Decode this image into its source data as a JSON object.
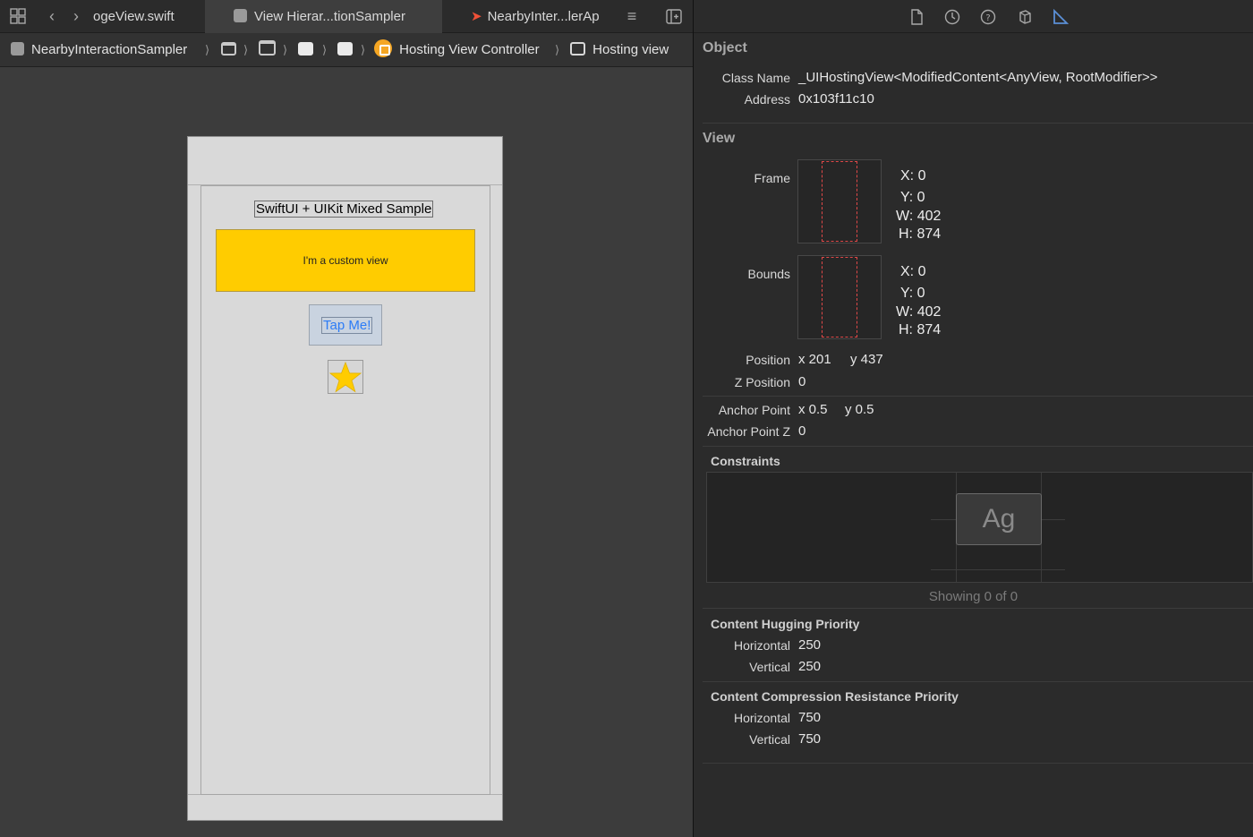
{
  "editor": {
    "tabs": [
      {
        "label": "ogeView.swift",
        "active": false
      },
      {
        "label": "View Hierar...tionSampler",
        "active": true
      },
      {
        "label": "NearbyInter...lerAp",
        "active": false
      }
    ],
    "jumpbar": {
      "project": "NearbyInteractionSampler",
      "controller": "Hosting View Controller",
      "view": "Hosting view"
    }
  },
  "device": {
    "title": "SwiftUI + UIKit Mixed Sample",
    "custom_view": "I'm a custom view",
    "button": "Tap Me!",
    "accent_color": "#ffcc00",
    "button_color": "#2c7cf6"
  },
  "inspector": {
    "object": {
      "section": "Object",
      "class_label": "Class Name",
      "class_value": "_UIHostingView<ModifiedContent<AnyView, RootModifier>>",
      "address_label": "Address",
      "address_value": "0x103f11c10"
    },
    "view": {
      "section": "View",
      "frame_label": "Frame",
      "frame": {
        "x": "X:  0",
        "y": "Y:  0",
        "w": "W:  402",
        "h": "H:  874"
      },
      "bounds_label": "Bounds",
      "bounds": {
        "x": "X:  0",
        "y": "Y:  0",
        "w": "W:  402",
        "h": "H:  874"
      },
      "position_label": "Position",
      "position_x": "x  201",
      "position_y": "y  437",
      "zpos_label": "Z Position",
      "zpos_value": "0",
      "anchor_label": "Anchor Point",
      "anchor_x": "x  0.5",
      "anchor_y": "y  0.5",
      "anchor_z_label": "Anchor Point Z",
      "anchor_z_value": "0"
    },
    "constraints": {
      "title": "Constraints",
      "preview_text": "Ag",
      "showing": "Showing 0 of 0"
    },
    "hugging": {
      "title": "Content Hugging Priority",
      "h_label": "Horizontal",
      "h_value": "250",
      "v_label": "Vertical",
      "v_value": "250"
    },
    "compression": {
      "title": "Content Compression Resistance Priority",
      "h_label": "Horizontal",
      "h_value": "750",
      "v_label": "Vertical",
      "v_value": "750"
    }
  }
}
